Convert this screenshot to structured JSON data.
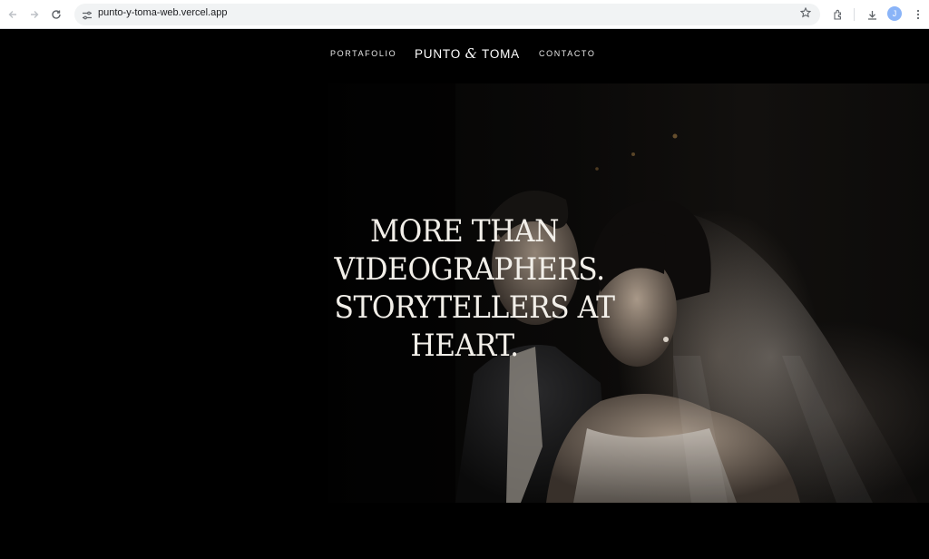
{
  "browser": {
    "url": "punto-y-toma-web.vercel.app",
    "avatar_letter": "J",
    "icons": [
      "back-icon",
      "forward-icon",
      "reload-icon",
      "site-settings-icon",
      "star-icon",
      "extensions-icon",
      "download-icon",
      "menu-icon"
    ]
  },
  "site": {
    "nav": {
      "left_link": "PORTAFOLIO",
      "brand_part1": "PUNTO ",
      "brand_amp": "&",
      "brand_part2": " TOMA",
      "right_link": "CONTACTO"
    },
    "hero": {
      "headline_lines": [
        "MORE THAN",
        "VIDEOGRAPHERS.",
        "STORYTELLERS AT",
        "HEART."
      ]
    }
  },
  "colors": {
    "page_background": "#000000",
    "text_light": "#f2efe9",
    "chrome_background": "#ffffff",
    "omnibox_background": "#f1f3f4"
  }
}
